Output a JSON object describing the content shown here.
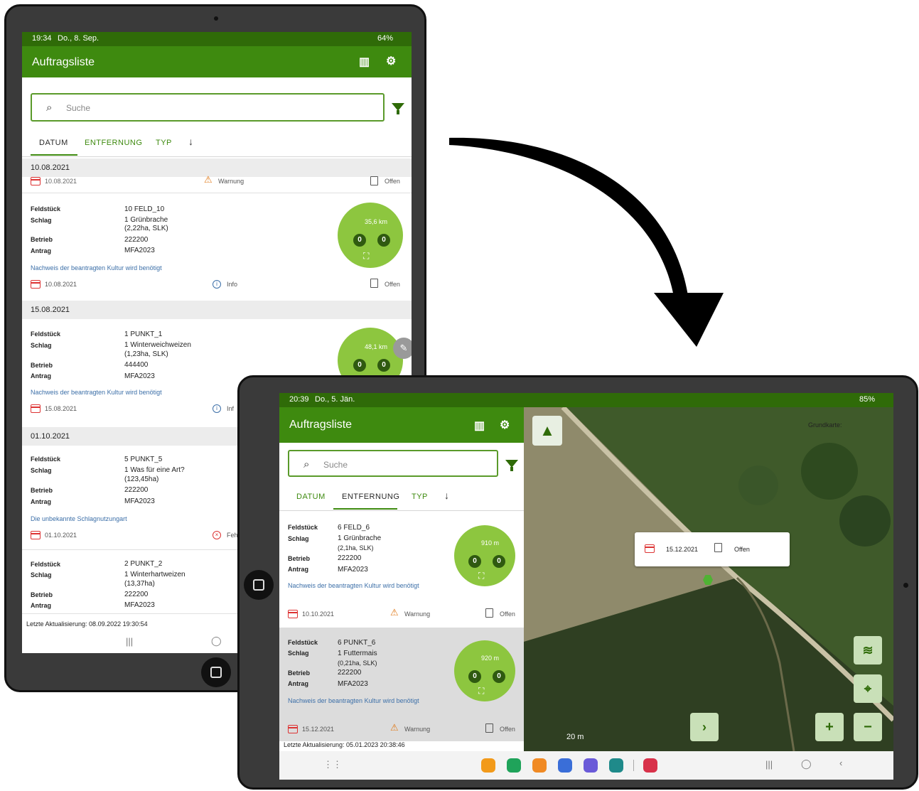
{
  "colors": {
    "brand": "#3e8a0f",
    "brand_dark": "#2f6b08",
    "bubble": "#8dc63f",
    "link": "#3c6fa8",
    "warning": "#e07a1a",
    "error": "#dd3333"
  },
  "left": {
    "status": {
      "time": "19:34",
      "date": "Do., 8. Sep.",
      "battery": "64%"
    },
    "title": "Auftragsliste",
    "search_placeholder": "Suche",
    "tabs": [
      "DATUM",
      "ENTFERNUNG",
      "TYP"
    ],
    "groups": [
      {
        "date": "10.08.2021"
      },
      {
        "date": "15.08.2021"
      },
      {
        "date": "01.10.2021"
      }
    ],
    "partial_row": {
      "date": "10.08.2021",
      "status": "Warnung",
      "state": "Offen"
    },
    "items": [
      {
        "feldstueck": "10  FELD_10",
        "schlag": "1  Grünbrache",
        "schlag2": "(2,22ha, SLK)",
        "betrieb": "222200",
        "antrag": "MFA2023",
        "dist": "35,6 km",
        "b1": "0",
        "b2": "0",
        "note": "Nachweis der beantragten Kultur wird benötigt",
        "date": "10.08.2021",
        "status": "Info",
        "state": "Offen"
      },
      {
        "feldstueck": "1  PUNKT_1",
        "schlag": "1  Winterweichweizen",
        "schlag2": "(1,23ha, SLK)",
        "betrieb": "444400",
        "antrag": "MFA2023",
        "dist": "48,1 km",
        "b1": "0",
        "b2": "0",
        "note": "Nachweis der beantragten Kultur wird benötigt",
        "date": "15.08.2021",
        "status": "Inf"
      },
      {
        "feldstueck": "5  PUNKT_5",
        "schlag": "1  Was für eine Art?",
        "schlag2": "(123,45ha)",
        "betrieb": "222200",
        "antrag": "MFA2023",
        "note": "Die unbekannte Schlagnutzungart",
        "date": "01.10.2021",
        "status": "Feh"
      },
      {
        "feldstueck": "2  PUNKT_2",
        "schlag": "1  Winterhartweizen",
        "schlag2": "(13,37ha)",
        "betrieb": "222200",
        "antrag": "MFA2023"
      }
    ],
    "labels": {
      "feldstueck": "Feldstück",
      "schlag": "Schlag",
      "betrieb": "Betrieb",
      "antrag": "Antrag"
    },
    "footer": "Letzte Aktualisierung: 08.09.2022 19:30:54"
  },
  "right": {
    "status": {
      "time": "20:39",
      "date": "Do., 5. Jän.",
      "battery": "85%"
    },
    "title": "Auftragsliste",
    "search_placeholder": "Suche",
    "tabs": [
      "DATUM",
      "ENTFERNUNG",
      "TYP"
    ],
    "items": [
      {
        "feldstueck": "6  FELD_6",
        "schlag": "1  Grünbrache",
        "schlag2": "(2,1ha, SLK)",
        "betrieb": "222200",
        "antrag": "MFA2023",
        "dist": "910 m",
        "b1": "0",
        "b2": "0",
        "note": "Nachweis der beantragten Kultur wird benötigt",
        "date": "10.10.2021",
        "status": "Warnung",
        "state": "Offen"
      },
      {
        "feldstueck": "6  PUNKT_6",
        "schlag": "1  Futtermais",
        "schlag2": "(0,21ha, SLK)",
        "betrieb": "222200",
        "antrag": "MFA2023",
        "dist": "920 m",
        "b1": "0",
        "b2": "0",
        "note": "Nachweis der beantragten Kultur wird benötigt",
        "date": "15.12.2021",
        "status": "Warnung",
        "state": "Offen"
      }
    ],
    "labels": {
      "feldstueck": "Feldstück",
      "schlag": "Schlag",
      "betrieb": "Betrieb",
      "antrag": "Antrag"
    },
    "footer": "Letzte Aktualisierung: 05.01.2023 20:38:46",
    "map": {
      "basemap_label": "Grundkarte:",
      "popup_date": "15.12.2021",
      "popup_state": "Offen",
      "scale": "20 m"
    }
  }
}
